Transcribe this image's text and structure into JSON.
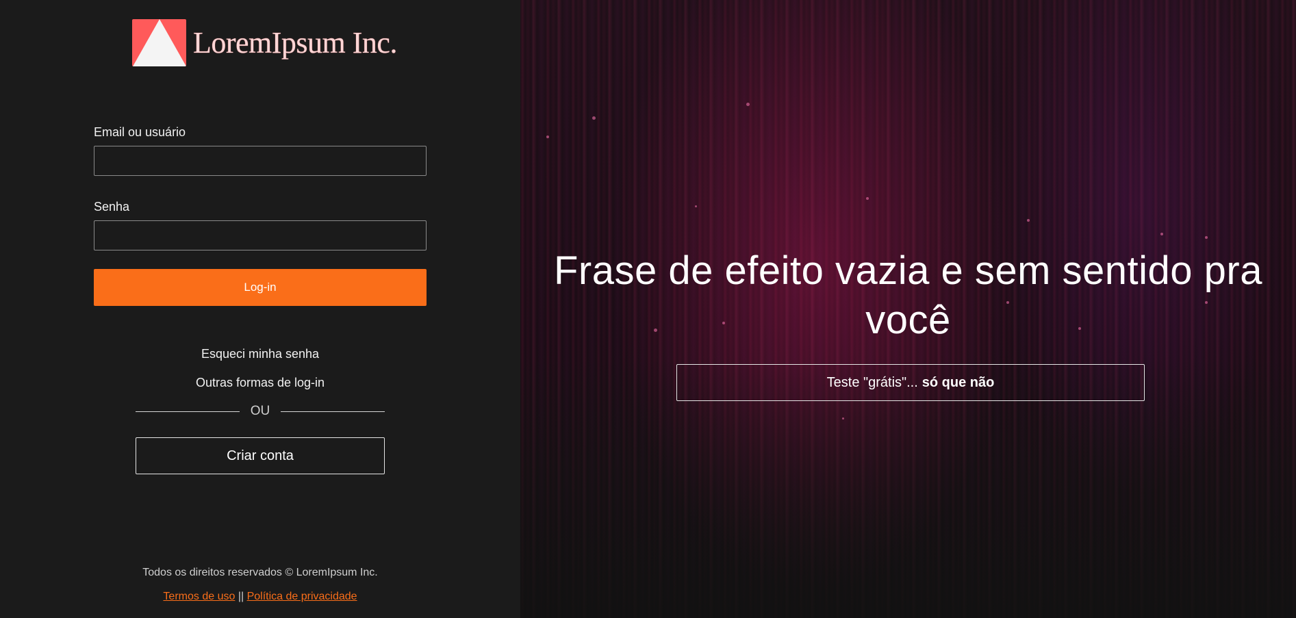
{
  "brand": {
    "name": "LoremIpsum Inc.",
    "logo_color": "#ff5a5a"
  },
  "form": {
    "email_label": "Email ou usuário",
    "email_value": "",
    "password_label": "Senha",
    "password_value": "",
    "login_label": "Log-in",
    "accent": "#fa6e19"
  },
  "links": {
    "forgot": "Esqueci minha senha",
    "other_login": "Outras formas de log-in",
    "divider": "OU",
    "create_account": "Criar conta"
  },
  "footer": {
    "copyright": "Todos os direitos reservados © LoremIpsum Inc.",
    "terms": "Termos de uso",
    "separator": "||",
    "privacy": "Política de privacidade"
  },
  "hero": {
    "headline": "Frase de efeito vazia e sem sentido pra você",
    "trial_prefix": "Teste \"grátis\"...",
    "trial_bold": "só que não"
  }
}
